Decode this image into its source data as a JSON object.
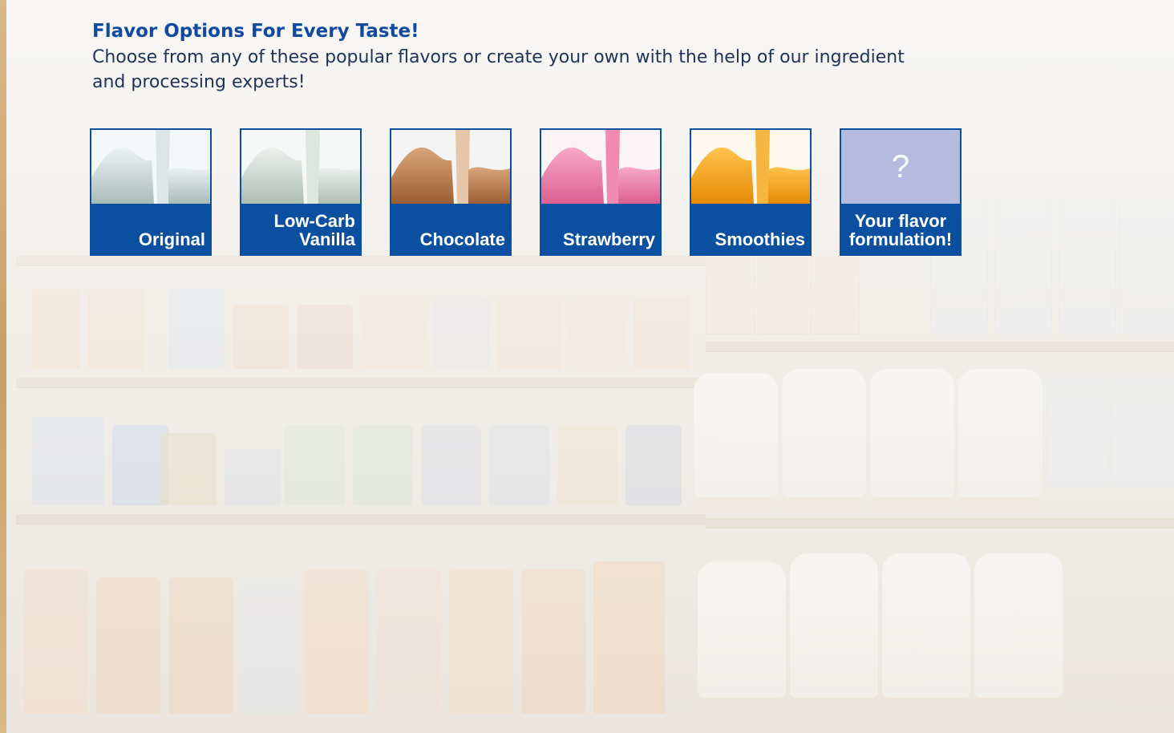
{
  "heading": "Flavor Options For Every Taste!",
  "intro": "Choose from any of these popular flavors or create your own with the help of our ingredient and processing experts!",
  "flavors": [
    {
      "label": "Original",
      "icon": "milk-splash-icon",
      "color": "#c9d6d3"
    },
    {
      "label": "Low-Carb\nVanilla",
      "icon": "milk-splash-icon",
      "color": "#cad5cf"
    },
    {
      "label": "Chocolate",
      "icon": "chocolate-splash-icon",
      "color": "#b97a4c"
    },
    {
      "label": "Strawberry",
      "icon": "strawberry-splash-icon",
      "color": "#ea7fa7"
    },
    {
      "label": "Smoothies",
      "icon": "orange-splash-icon",
      "color": "#f2a51c"
    },
    {
      "label": "Your flavor\nformulation!",
      "icon": "question-mark-icon",
      "symbol": "?"
    }
  ],
  "colors": {
    "heading": "#0f4aa0",
    "tile": "#0b4fa0",
    "placeholder": "#b4bbde"
  }
}
